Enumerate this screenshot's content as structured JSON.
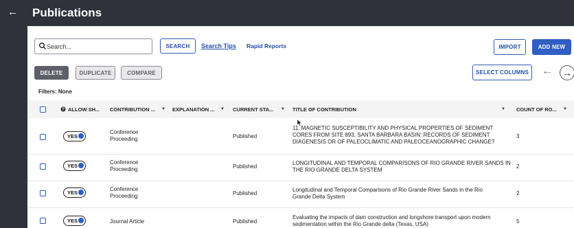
{
  "header": {
    "back_icon": "back-arrow-icon",
    "title": "Publications"
  },
  "search": {
    "placeholder": "Search...",
    "value": "",
    "search_button": "SEARCH",
    "tips_link": "Search Tips",
    "rapid_reports_link": "Rapid Reports"
  },
  "toolbar": {
    "import": "IMPORT",
    "add_new": "ADD NEW",
    "delete": "DELETE",
    "duplicate": "DUPLICATE",
    "compare": "COMPARE",
    "select_columns": "SELECT COLUMNS",
    "prev_icon": "arrow-left-icon",
    "next_icon": "arrow-right-icon"
  },
  "filters_label": "Filters: None",
  "columns": [
    {
      "key": "allow",
      "label": "ALLOW SH...",
      "icon": "question-icon"
    },
    {
      "key": "type",
      "label": "CONTRIBUTION ..."
    },
    {
      "key": "explanation",
      "label": "EXPLANATION ..."
    },
    {
      "key": "status",
      "label": "CURRENT STA..."
    },
    {
      "key": "title",
      "label": "TITLE OF CONTRIBUTION"
    },
    {
      "key": "count",
      "label": "COUNT OF RO..."
    }
  ],
  "rows": [
    {
      "allow": "YES",
      "type_line1": "Conference",
      "type_line2": "Proceeding",
      "status": "Published",
      "title_lines": [
        "11. MAGNETIC SUSCEPTIBILITY AND PHYSICAL PROPERTIES OF SEDIMENT",
        "CORES FROM SITE 893, SANTA BARBARA BASIN: RECORDS OF SEDIMENT",
        "DIAGENESIS OR OF PALEOCLIMATIC AND PALEOCEANOGRAPHIC CHANGE?"
      ],
      "count": "3"
    },
    {
      "allow": "YES",
      "type_line1": "Conference",
      "type_line2": "Proceeding",
      "status": "Published",
      "title_lines": [
        "LONGITUDINAL AND TEMPORAL COMPARISONS OF RIO GRANDE RIVER SANDS IN",
        "THE RIO GRANDE DELTA SYSTEM"
      ],
      "count": "2"
    },
    {
      "allow": "YES",
      "type_line1": "Conference",
      "type_line2": "Proceeding",
      "status": "Published",
      "title_lines": [
        "Longitudinal and Temporal Comparisons of Rio Grande River Sands in the Rio",
        "Grande Delta System"
      ],
      "count": "2"
    },
    {
      "allow": "YES",
      "type_line1": "Journal Article",
      "type_line2": "",
      "status": "Published",
      "title_lines": [
        "Evaluating the impacts of dam construction and longshore transport upon modern",
        "sedimentation within the Rio Grande delta (Texas, USA)"
      ],
      "count": "5"
    }
  ],
  "colors": {
    "header_bg": "#2f323a",
    "accent": "#2f5ec4",
    "link": "#2350a8"
  }
}
